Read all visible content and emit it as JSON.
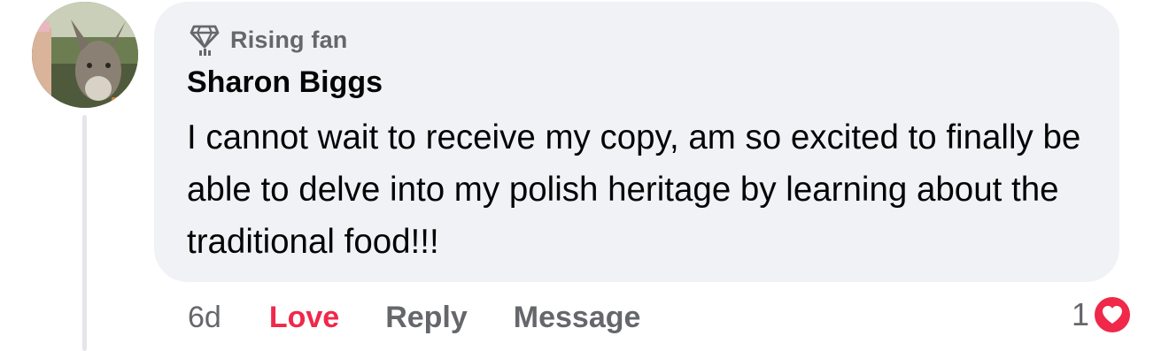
{
  "comment": {
    "badge": {
      "icon": "diamond-badge-icon",
      "label": "Rising fan"
    },
    "author": "Sharon Biggs",
    "text": "I cannot wait to receive my copy, am so excited to finally be able to delve into my polish heritage by learning about the traditional food!!!",
    "avatar": "profile-photo-donkey"
  },
  "actions": {
    "age": "6d",
    "love_label": "Love",
    "reply_label": "Reply",
    "message_label": "Message"
  },
  "reactions": {
    "count": "1",
    "icon": "heart-icon"
  },
  "colors": {
    "bubble": "#f0f2f5",
    "primary_text": "#050505",
    "secondary_text": "#65676b",
    "love_accent": "#f02849",
    "thread_line": "#e4e6eb"
  }
}
